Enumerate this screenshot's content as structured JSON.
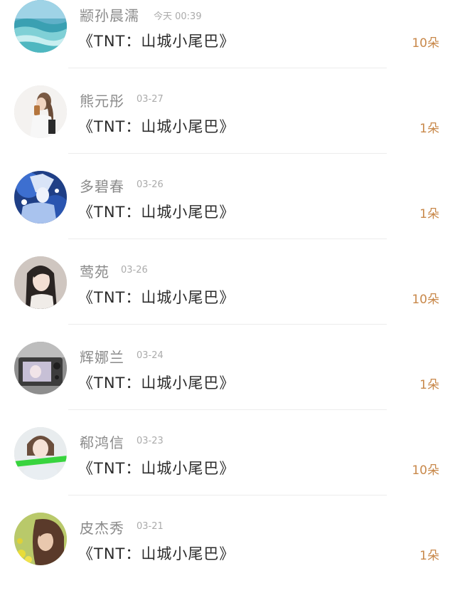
{
  "list": {
    "items": [
      {
        "name": "颛孙晨濡",
        "time": "今天 00:39",
        "gift": "《TNT：山城小尾巴》",
        "count": "10朵",
        "avatar_icon": "avatar-ocean-wave"
      },
      {
        "name": "熊元彤",
        "time": "03-27",
        "gift": "《TNT：山城小尾巴》",
        "count": "1朵",
        "avatar_icon": "avatar-girl-drinking"
      },
      {
        "name": "多碧春",
        "time": "03-26",
        "gift": "《TNT：山城小尾巴》",
        "count": "1朵",
        "avatar_icon": "avatar-anime-blue"
      },
      {
        "name": "莺苑",
        "time": "03-26",
        "gift": "《TNT：山城小尾巴》",
        "count": "10朵",
        "avatar_icon": "avatar-girl-portrait"
      },
      {
        "name": "辉娜兰",
        "time": "03-24",
        "gift": "《TNT：山城小尾巴》",
        "count": "1朵",
        "avatar_icon": "avatar-camera-screen"
      },
      {
        "name": "郗鸿信",
        "time": "03-23",
        "gift": "《TNT：山城小尾巴》",
        "count": "10朵",
        "avatar_icon": "avatar-girl-green-banner"
      },
      {
        "name": "皮杰秀",
        "time": "03-21",
        "gift": "《TNT：山城小尾巴》",
        "count": "1朵",
        "avatar_icon": "avatar-girl-yellow-flowers"
      }
    ]
  },
  "colors": {
    "name": "#8a8a8a",
    "time": "#ababab",
    "gift": "#2b2b2b",
    "count": "#c8884a",
    "divider": "#ececec"
  }
}
